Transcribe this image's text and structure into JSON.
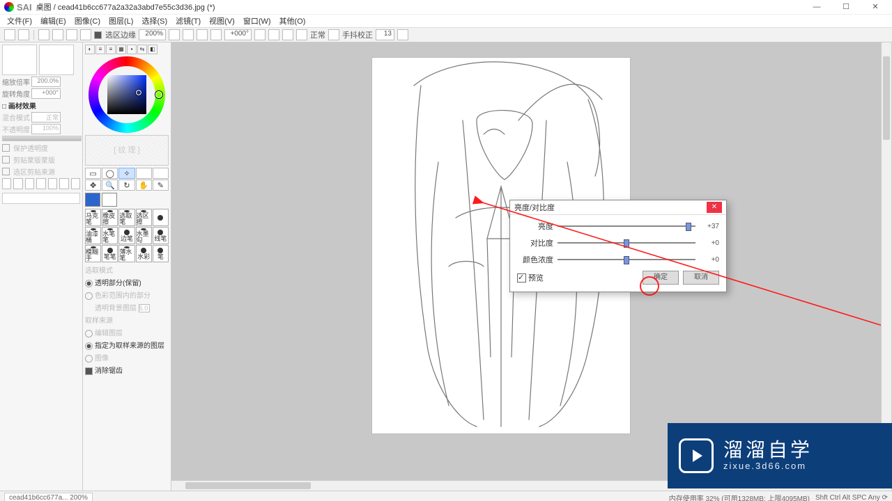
{
  "app": {
    "logo": "SAI",
    "title": "桌图 / cead41b6cc677a2a32a3abd7e55c3d36.jpg (*)"
  },
  "win": {
    "min": "—",
    "max": "☐",
    "close": "✕"
  },
  "menu": [
    "文件(F)",
    "编辑(E)",
    "图像(C)",
    "图层(L)",
    "选择(S)",
    "滤镜(T)",
    "视图(V)",
    "窗口(W)",
    "其他(O)"
  ],
  "toolbar": {
    "selTrack": "选区边缘",
    "zoom": "200%",
    "rot": "+000°",
    "blend": "正常",
    "stab": "手抖校正",
    "stabVal": "13"
  },
  "left": {
    "zoomLabel": "缩放倍率",
    "zoomVal": "200.0%",
    "rotLabel": "旋转角度",
    "rotVal": "+000°",
    "materials": "□ 画材效果",
    "modeLabel": "混合模式",
    "modeVal": "正常",
    "opLabel": "不透明度",
    "opVal": "100%",
    "c1": "保护透明度",
    "c2": "剪贴蒙版蒙版",
    "c3": "选区剪贴来源"
  },
  "tools": {
    "texLabel": "[ 纹 理 ]",
    "brushes": [
      "马克笔",
      "橡皮擦",
      "选取笔",
      "选区擦",
      "",
      "油漆桶",
      "水笔笔",
      "边笔",
      "水墨勾",
      "线笔",
      "模糊手",
      "笔笔",
      "薄水笔",
      "水彩",
      "笔"
    ],
    "optHdr1": "选取模式",
    "opt1": "透明部分(保留)",
    "opt2": "色彩范围内的部分",
    "opt3": "透明背景图层",
    "optVal": "5.0",
    "optHdr2": "取样来源",
    "opt4": "编辑图层",
    "opt5": "指定为取样来源的图层",
    "opt6": "图像",
    "opt7": "消除锯齿"
  },
  "dialog": {
    "title": "亮度/对比度",
    "rows": [
      {
        "label": "亮度",
        "val": "+37",
        "pos": 0.93
      },
      {
        "label": "对比度",
        "val": "+0",
        "pos": 0.48
      },
      {
        "label": "颜色浓度",
        "val": "+0",
        "pos": 0.48
      }
    ],
    "preview": "预览",
    "ok": "确定",
    "cancel": "取消"
  },
  "status": {
    "doc": "cead41b6cc677a... 200%",
    "mem": "内存使用率 32% (可用1328MB; 上限4095MB)",
    "keys": "Shft Ctrl Alt SPC Any ⟳"
  },
  "brand": {
    "cn": "溜溜自学",
    "url": "zixue.3d66.com"
  }
}
